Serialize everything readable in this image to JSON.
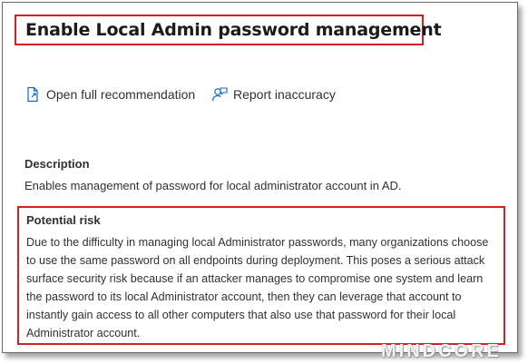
{
  "panel": {
    "title": "Enable Local Admin password management"
  },
  "actions": {
    "open_recommendation_label": "Open full recommendation",
    "open_recommendation_icon": "open-document-icon",
    "report_inaccuracy_label": "Report inaccuracy",
    "report_inaccuracy_icon": "person-feedback-icon"
  },
  "description": {
    "heading": "Description",
    "text": "Enables management of password for local administrator account in AD."
  },
  "potential_risk": {
    "heading": "Potential risk",
    "text": "Due to the difficulty in managing local Administrator passwords, many organizations choose to use the same password on all endpoints during deployment. This poses a serious attack surface security risk because if an attacker manages to compromise one system and learn the password to its local Administrator account, then they can leverage that account to instantly gain access to all other computers that also use that password for their local Administrator account."
  },
  "watermark": {
    "text": "MINDCORE"
  },
  "colors": {
    "highlight_border": "#d71f26",
    "text": "#323130",
    "icon_accent": "#0f6cbd"
  }
}
